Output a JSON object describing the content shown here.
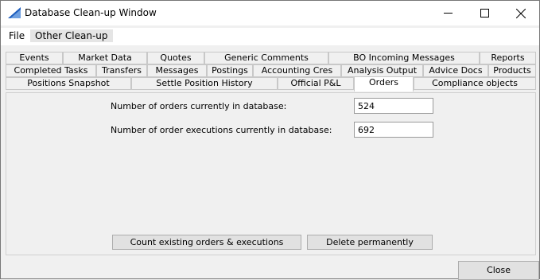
{
  "window": {
    "title": "Database Clean-up Window",
    "controls": {
      "minimize": "—",
      "maximize": "☐",
      "close": "✕"
    }
  },
  "menu": [
    "File",
    "Other Clean-up"
  ],
  "tabs": {
    "row1": [
      "Events",
      "Market Data",
      "Quotes",
      "Generic Comments",
      "BO Incoming Messages",
      "Reports"
    ],
    "row2": [
      "Completed Tasks",
      "Transfers",
      "Messages",
      "Postings",
      "Accounting Cres",
      "Analysis Output",
      "Advice Docs",
      "Products"
    ],
    "row3": [
      "Positions Snapshot",
      "Settle Position History",
      "Official P&L",
      "Orders",
      "Compliance objects"
    ],
    "selected": "Orders"
  },
  "orders": {
    "orders_label": "Number of orders currently in database:",
    "orders_value": "524",
    "executions_label": "Number of order executions currently in database:",
    "executions_value": "692",
    "count_button": "Count existing orders & executions",
    "delete_button": "Delete permanently"
  },
  "close_button": "Close",
  "colors": {
    "selected_tab": "#ffffff",
    "accent": "#1f5fbf"
  }
}
